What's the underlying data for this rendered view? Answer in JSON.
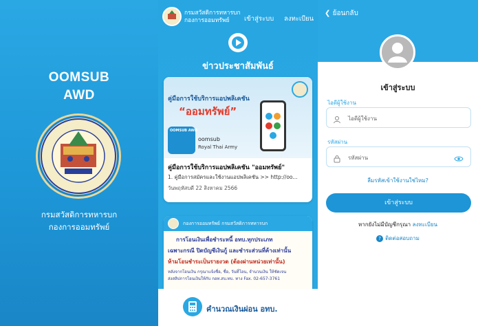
{
  "splash": {
    "title_line1": "OOMSUB",
    "title_line2": "AWD",
    "org_line1": "กรมสวัสดิการทหารบก",
    "org_line2": "กองการออมทรัพย์",
    "seal_text_top": "กรมสวัสดิการทหารบก",
    "seal_text_bottom": "กองการออมทรัพย์"
  },
  "news": {
    "brand_line1": "กรมสวัสดิการทหารบก",
    "brand_line2": "กองการออมทรัพย์",
    "nav_login": "เข้าสู่ระบบ",
    "nav_register": "ลงทะเบียน",
    "section_title": "ข่าวประชาสัมพันธ์",
    "card1": {
      "banner_heading": "คู่มือการใช้บริการแอปพลิเคชัน",
      "banner_app_name": "“ออมทรัพย์”",
      "tile_label": "OOMSUB AWD",
      "banner_brand": "oomsub",
      "banner_sub": "Royal Thai Army",
      "title": "คู่มือการใช้บริการแอปพลิเคชัน \"ออมทรัพย์\"",
      "desc": "1. คู่มือการสมัครและใช้งานแอปพลิเคชัน >> http://oo...",
      "date": "วันพฤหัสบดี 22 สิงหาคม 2566"
    },
    "card2": {
      "header": "กองการออมทรัพย์ กรมสวัสดิการทหารบก",
      "line1": "การโอนเงินเพื่อชำระหนี้ อทบ.ทุกประเภท",
      "line2": "เฉพาะกรณี ปิดบัญชีเงินกู้ และชำระส่วนที่ค้างเท่านั้น",
      "line3": "ห้ามโอนชำระเป็นรายงวด (ต้องผ่านหน่วยเท่านั้น)",
      "line4": "หลังจากโอนเงิน กรุณาแจ้งชื่อ, ชื่อ, วันที่โอน, จำนวนเงิน ให้ชัดเจน",
      "line5": "ส่งสลิปการโอนเงินให้กับ กอท.สบ.ทบ. ทาง Fax. 02-657-3761"
    },
    "calc_label": "คำนวณเงินผ่อน อทบ."
  },
  "login": {
    "back_label": "ย้อนกลับ",
    "title": "เข้าสู่ระบบ",
    "username_label": "ไอดีผู้ใช้งาน",
    "username_placeholder": "ไอดีผู้ใช้งาน",
    "password_label": "รหัสผ่าน",
    "password_placeholder": "รหัสผ่าน",
    "forgot": "ลืมรหัสเข้าใช้งานใช่ไหม?",
    "submit": "เข้าสู่ระบบ",
    "no_account": "หากยังไม่มีบัญชีกรุณา",
    "register_link": "ลงทะเบียน",
    "contact": "ติดต่อสอบถาม"
  },
  "colors": {
    "primary": "#2aa8e4",
    "primary_dark": "#1d95d6",
    "accent_red": "#e23b2c",
    "text_dark": "#222222"
  }
}
